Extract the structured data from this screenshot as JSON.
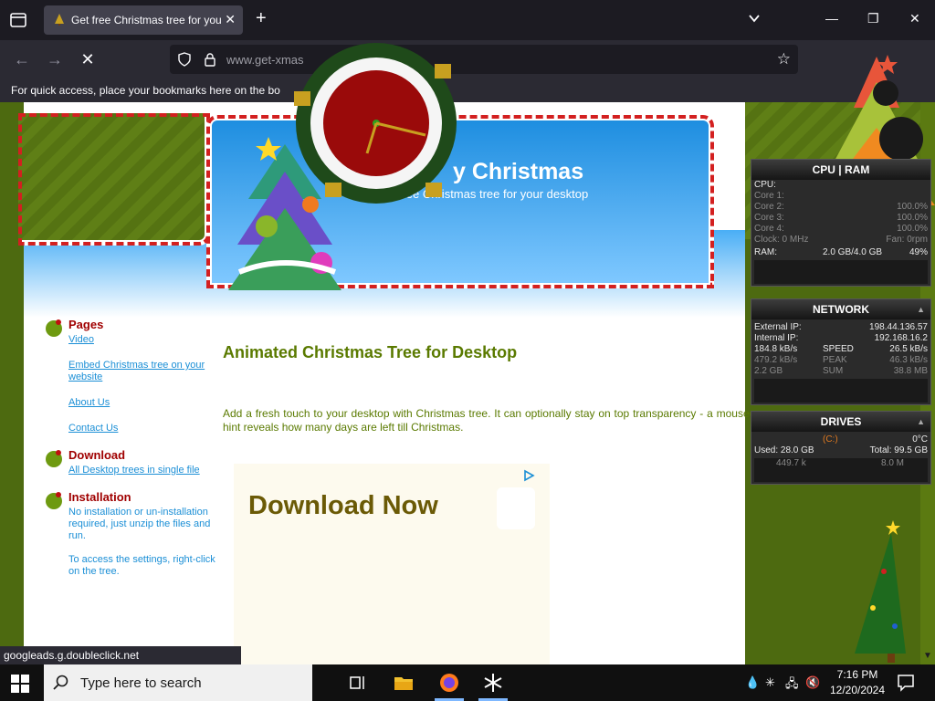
{
  "browser": {
    "tab_title": "Get free Christmas tree for your",
    "url": "www.get-xmas",
    "bookmark_hint": "For quick access, place your bookmarks here on the bo",
    "status_url": "googleads.g.doubleclick.net"
  },
  "site": {
    "title": "y Christmas",
    "subtitle": "a free Christmas tree for your desktop",
    "main_title": "Animated Christmas Tree for Desktop",
    "description": "Add a fresh touch to your desktop with Christmas tree. It can optionally stay on top transparency - a mouseover hint reveals how many days are left till Christmas.",
    "ad_title": "Download Now"
  },
  "sidebar": {
    "pages_heading": "Pages",
    "links": [
      "Video",
      "Embed Christmas tree on your website",
      "About Us",
      "Contact Us"
    ],
    "download_heading": "Download",
    "download_link": "All Desktop trees in single file",
    "install_heading": "Installation",
    "install_text": "No installation or un-installation required, just unzip the files and run.",
    "settings_text": "To access the settings, right-click on the tree."
  },
  "cpu_widget": {
    "title": "CPU | RAM",
    "cpu_label": "CPU:",
    "cores": [
      {
        "label": "Core 1:",
        "value": ""
      },
      {
        "label": "Core 2:",
        "value": "100.0%"
      },
      {
        "label": "Core 3:",
        "value": "100.0%"
      },
      {
        "label": "Core 4:",
        "value": "100.0%"
      }
    ],
    "clock": "Clock: 0 MHz",
    "fan": "Fan: 0rpm",
    "ram_label": "RAM:",
    "ram_value": "2.0 GB/4.0 GB",
    "ram_pct": "49%"
  },
  "network_widget": {
    "title": "NETWORK",
    "external_label": "External IP:",
    "external_ip": "198.44.136.57",
    "internal_label": "Internal IP:",
    "internal_ip": "192.168.16.2",
    "down_speed": "184.8 kB/s",
    "speed_label": "SPEED",
    "up_speed": "26.5 kB/s",
    "down_peak": "479.2 kB/s",
    "peak_label": "PEAK",
    "up_peak": "46.3 kB/s",
    "down_sum": "2.2 GB",
    "sum_label": "SUM",
    "up_sum": "38.8 MB"
  },
  "drives_widget": {
    "title": "DRIVES",
    "drive": "(C:)",
    "temp": "0°C",
    "used": "Used: 28.0 GB",
    "total": "Total: 99.5 GB",
    "read": "449.7 k",
    "write": "8.0 M"
  },
  "taskbar": {
    "search_placeholder": "Type here to search",
    "time": "7:16 PM",
    "date": "12/20/2024"
  }
}
